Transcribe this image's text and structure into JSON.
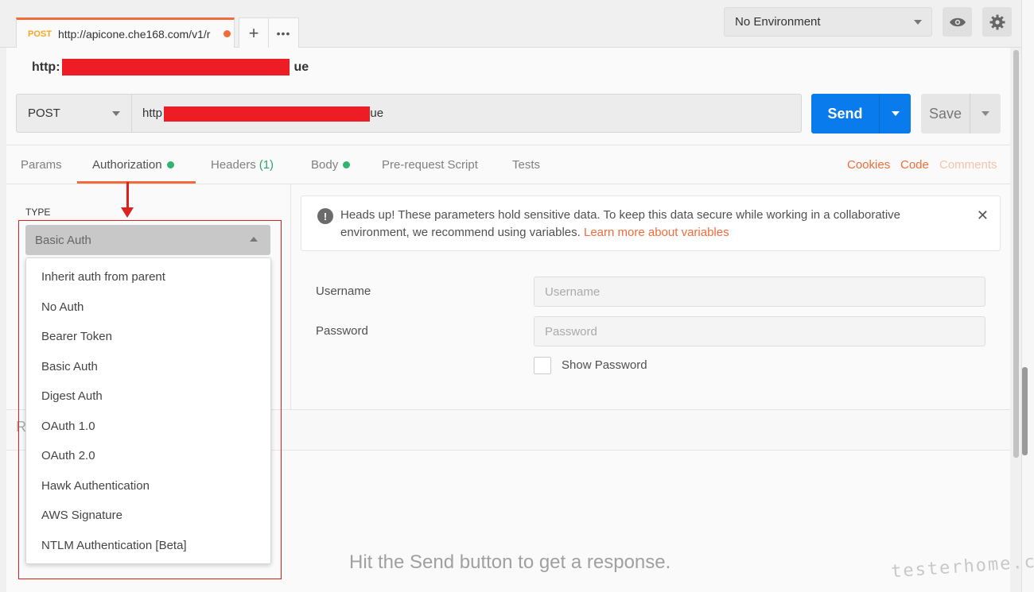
{
  "tabbar": {
    "request_tab": {
      "method": "POST",
      "url": "http://apicone.che168.com/v1/r"
    },
    "add_tab": "+",
    "more_tabs": "•••",
    "environment": "No Environment"
  },
  "request": {
    "title_prefix": "http:",
    "title_suffix": "ue",
    "method": "POST",
    "url_prefix": "http",
    "url_suffix": "lue",
    "send_label": "Send",
    "save_label": "Save"
  },
  "subtabs": {
    "params": "Params",
    "authorization": "Authorization",
    "headers": "Headers",
    "headers_count": "(1)",
    "body": "Body",
    "prerequest": "Pre-request Script",
    "tests": "Tests",
    "cookies": "Cookies",
    "code": "Code",
    "comments": "Comments"
  },
  "auth": {
    "type_label": "TYPE",
    "selected": "Basic Auth",
    "options": [
      "Inherit auth from parent",
      "No Auth",
      "Bearer Token",
      "Basic Auth",
      "Digest Auth",
      "OAuth 1.0",
      "OAuth 2.0",
      "Hawk Authentication",
      "AWS Signature",
      "NTLM Authentication [Beta]"
    ]
  },
  "alert": {
    "text": "Heads up! These parameters hold sensitive data. To keep this data secure while working in a collaborative environment, we recommend using variables.",
    "link": "Learn more about variables"
  },
  "form": {
    "username_label": "Username",
    "username_placeholder": "Username",
    "password_label": "Password",
    "password_placeholder": "Password",
    "show_password": "Show Password"
  },
  "response": {
    "header_initial": "R",
    "empty_message": "Hit the Send button to get a response."
  },
  "watermark": "testerhome.com",
  "colors": {
    "accent": "#f26b3a",
    "send": "#097bed",
    "status_dot": "#2fb36f",
    "annotation": "#e02020"
  }
}
